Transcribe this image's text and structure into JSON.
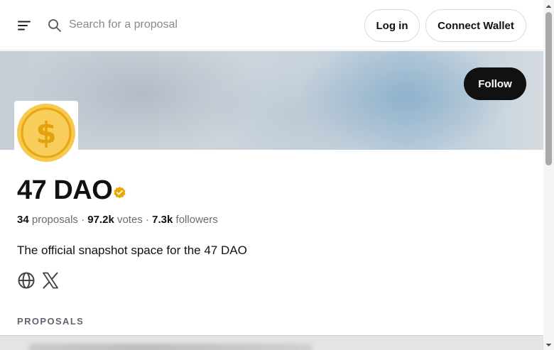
{
  "header": {
    "search": {
      "placeholder": "Search for a proposal",
      "value": ""
    },
    "login_label": "Log in",
    "connect_label": "Connect Wallet",
    "icons": {
      "menu": "menu-icon",
      "search": "search-icon"
    }
  },
  "banner": {
    "follow_label": "Follow"
  },
  "space": {
    "avatar_symbol": "$",
    "name": "47 DAO",
    "verified_icon": "verified-badge-icon",
    "stats": {
      "proposals_count": "34",
      "proposals_label": "proposals",
      "separator": " · ",
      "votes_count": "97.2k",
      "votes_label": "votes",
      "followers_count": "7.3k",
      "followers_label": "followers"
    },
    "about": "The official snapshot space for the 47 DAO",
    "links": [
      "globe-icon",
      "x-icon"
    ]
  },
  "sections": {
    "proposals_title": "PROPOSALS"
  },
  "colors": {
    "accent_dark": "#111111",
    "verified": "#e8a800",
    "avatar_fill": "#f8c94f",
    "avatar_ring": "#f3b51d",
    "avatar_symbol": "#e2a20c"
  }
}
